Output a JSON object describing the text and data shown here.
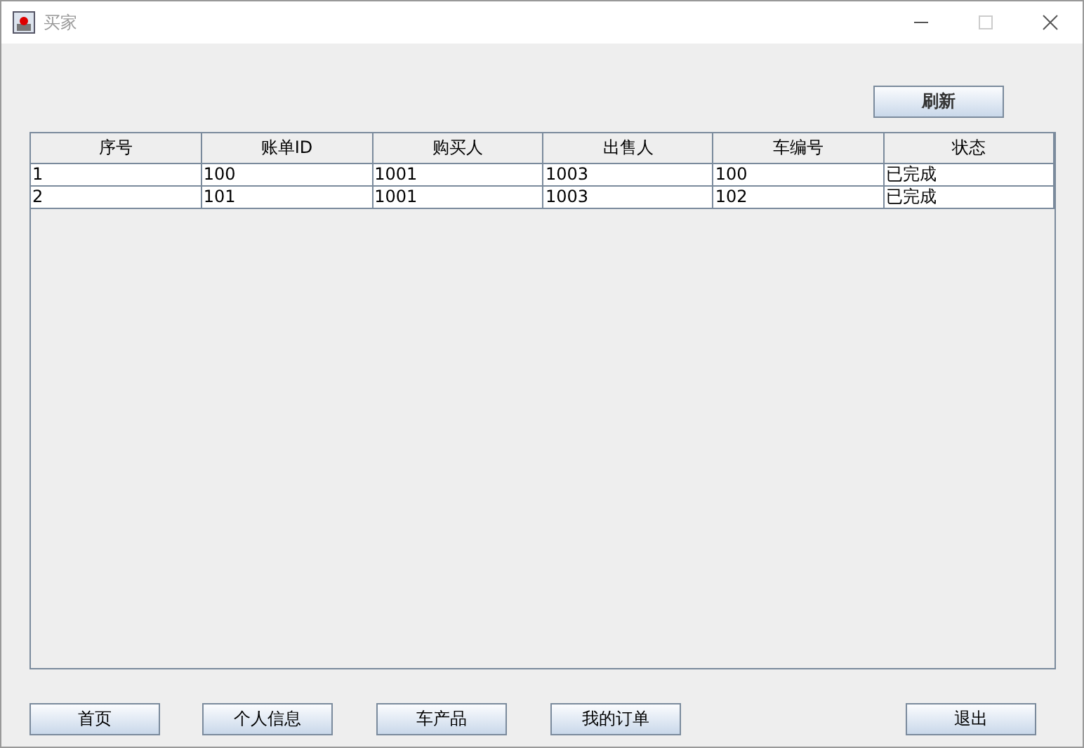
{
  "window": {
    "title": "买家"
  },
  "refresh_button": "刷新",
  "table": {
    "columns": [
      "序号",
      "账单ID",
      "购买人",
      "出售人",
      "车编号",
      "状态"
    ],
    "rows": [
      [
        "1",
        "100",
        "1001",
        "1003",
        "100",
        "已完成"
      ],
      [
        "2",
        "101",
        "1001",
        "1003",
        "102",
        "已完成"
      ]
    ]
  },
  "nav_buttons": [
    "首页",
    "个人信息",
    "车产品",
    "我的订单"
  ],
  "exit_button": "退出"
}
